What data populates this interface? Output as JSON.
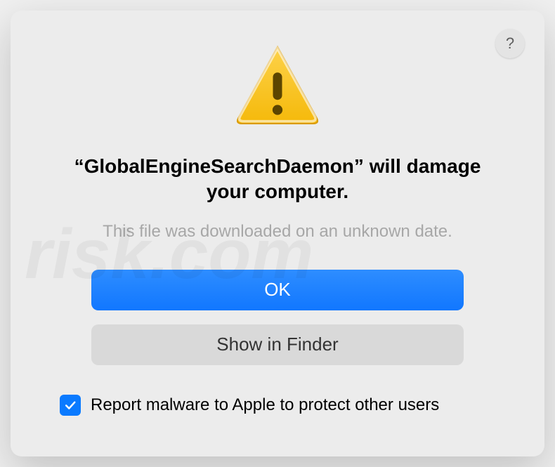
{
  "dialog": {
    "message_main": "“GlobalEngineSearchDaemon” will damage your computer.",
    "message_sub": "This file was downloaded on an unknown date.",
    "ok_label": "OK",
    "show_in_finder_label": "Show in Finder",
    "checkbox_label": "Report malware to Apple to protect other users",
    "help_label": "?",
    "checkbox_checked": true
  }
}
